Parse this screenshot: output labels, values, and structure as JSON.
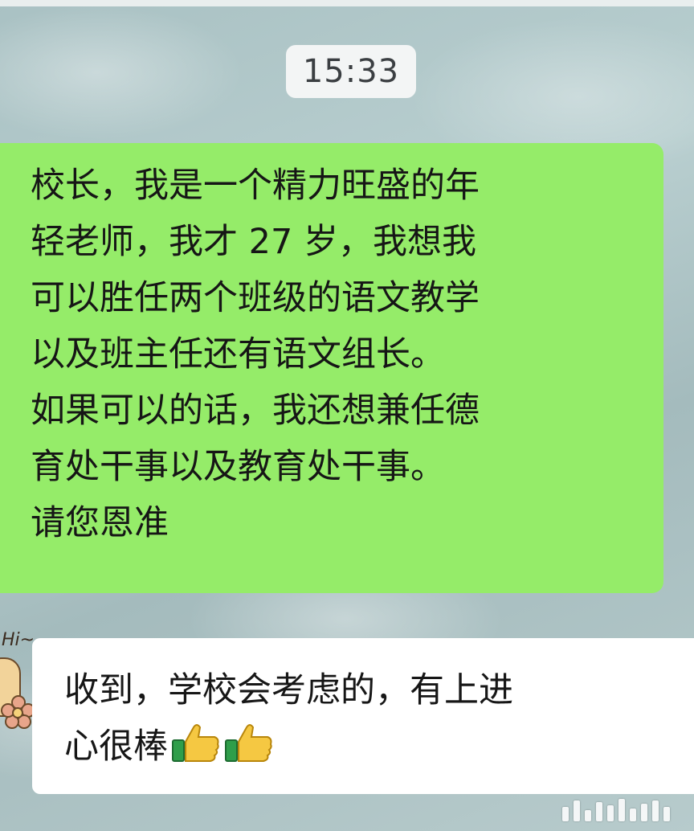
{
  "chat": {
    "timestamp": "15:33",
    "sent_message": {
      "text": "校长，我是一个精力旺盛的年\n轻老师，我才 27 岁，我想我\n可以胜任两个班级的语文教学\n以及班主任还有语文组长。\n如果可以的话，我还想兼任德\n育处干事以及教育处干事。\n请您恩准"
    },
    "received_message": {
      "text_line1": "收到，学校会考虑的，有上进",
      "text_line2": "心很棒",
      "emoji": [
        "thumbs-up-icon",
        "thumbs-up-icon"
      ]
    },
    "avatar": {
      "caption": "Hi~"
    }
  },
  "colors": {
    "sent_bubble": "#95ec69",
    "received_bubble": "#ffffff",
    "time_pill": "#f3f5f5",
    "text": "#161616"
  }
}
